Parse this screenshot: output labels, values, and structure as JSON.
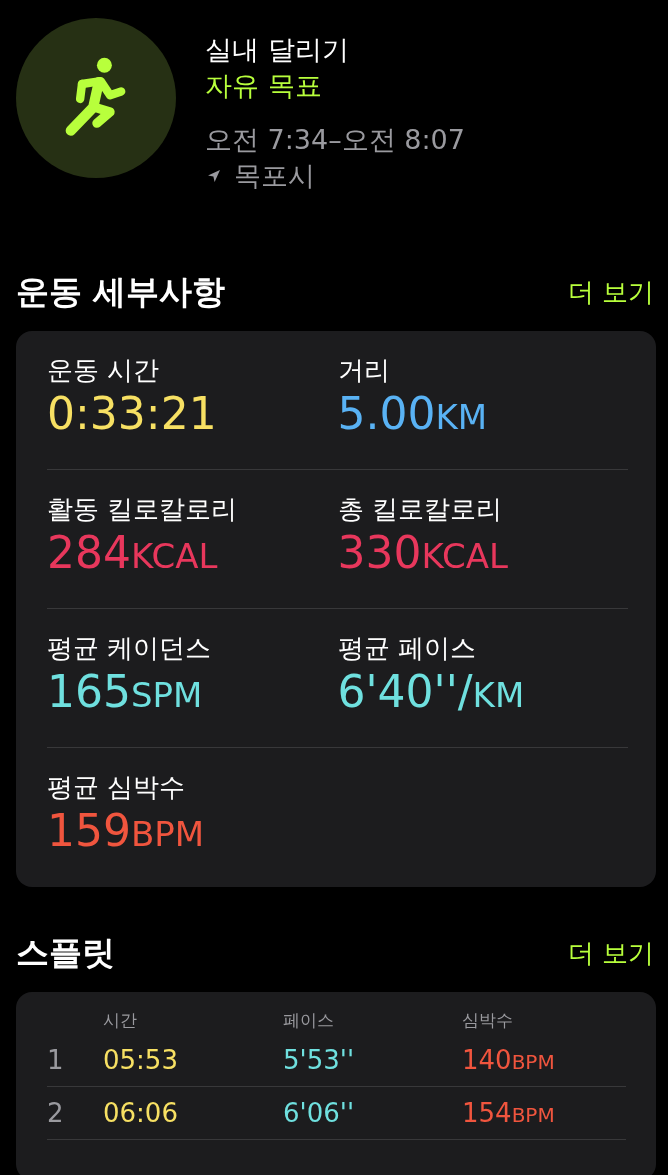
{
  "workout": {
    "title": "실내 달리기",
    "goal": "자유 목표",
    "time": "오전 7:34–오전 8:07",
    "location": "목포시"
  },
  "details": {
    "title": "운동 세부사항",
    "more": "더 보기",
    "metrics": [
      {
        "label": "운동 시간",
        "value": "0:33:21",
        "color": "#f7e063"
      },
      {
        "label": "거리",
        "value": "5.00",
        "unit": "KM",
        "color": "#59b2f4"
      },
      {
        "label": "활동 킬로칼로리",
        "value": "284",
        "unit": "KCAL",
        "color": "#e8375c"
      },
      {
        "label": "총 킬로칼로리",
        "value": "330",
        "unit": "KCAL",
        "color": "#e8375c"
      },
      {
        "label": "평균 케이던스",
        "value": "165",
        "unit": "SPM",
        "color": "#6fe0df"
      },
      {
        "label": "평균 페이스",
        "value": "6'40''/",
        "unit": "KM",
        "color": "#6fe0df"
      },
      {
        "label": "평균 심박수",
        "value": "159",
        "unit": "BPM",
        "color": "#f0553e"
      }
    ]
  },
  "splits": {
    "title": "스플릿",
    "more": "더 보기",
    "columns": [
      "시간",
      "페이스",
      "심박수"
    ],
    "rows": [
      {
        "index": "1",
        "time": "05:53",
        "pace": "5'53''",
        "heart_rate": "140",
        "unit": "BPM"
      },
      {
        "index": "2",
        "time": "06:06",
        "pace": "6'06''",
        "heart_rate": "154",
        "unit": "BPM"
      }
    ]
  }
}
